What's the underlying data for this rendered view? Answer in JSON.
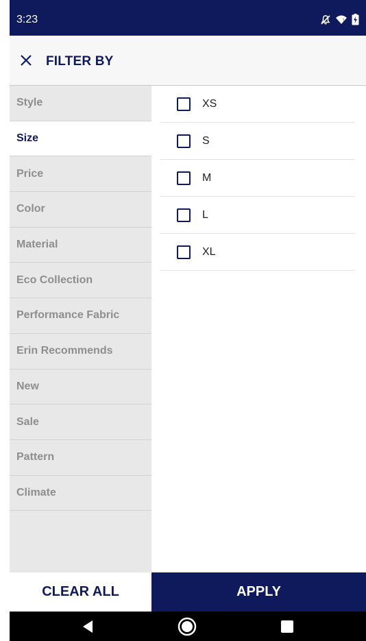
{
  "status_bar": {
    "time": "3:23",
    "icons": [
      "notifications-off-icon",
      "wifi-icon",
      "battery-charging-icon"
    ]
  },
  "header": {
    "close_icon": "close-icon",
    "title": "FILTER BY"
  },
  "categories": [
    {
      "label": "Style",
      "active": false
    },
    {
      "label": "Size",
      "active": true
    },
    {
      "label": "Price",
      "active": false
    },
    {
      "label": "Color",
      "active": false
    },
    {
      "label": "Material",
      "active": false
    },
    {
      "label": "Eco Collection",
      "active": false
    },
    {
      "label": "Performance Fabric",
      "active": false
    },
    {
      "label": "Erin Recommends",
      "active": false
    },
    {
      "label": "New",
      "active": false
    },
    {
      "label": "Sale",
      "active": false
    },
    {
      "label": "Pattern",
      "active": false
    },
    {
      "label": "Climate",
      "active": false
    }
  ],
  "size_options": [
    {
      "label": "XS",
      "checked": false
    },
    {
      "label": "S",
      "checked": false
    },
    {
      "label": "M",
      "checked": false
    },
    {
      "label": "L",
      "checked": false
    },
    {
      "label": "XL",
      "checked": false
    }
  ],
  "buttons": {
    "clear_all": "CLEAR ALL",
    "apply": "APPLY"
  },
  "nav_bar": {
    "icons": [
      "back-icon",
      "home-icon",
      "recents-icon"
    ]
  },
  "colors": {
    "brand_navy": "#0e1a5b",
    "category_bg": "#e8e8e8",
    "inactive_text": "#8e8e8e"
  }
}
